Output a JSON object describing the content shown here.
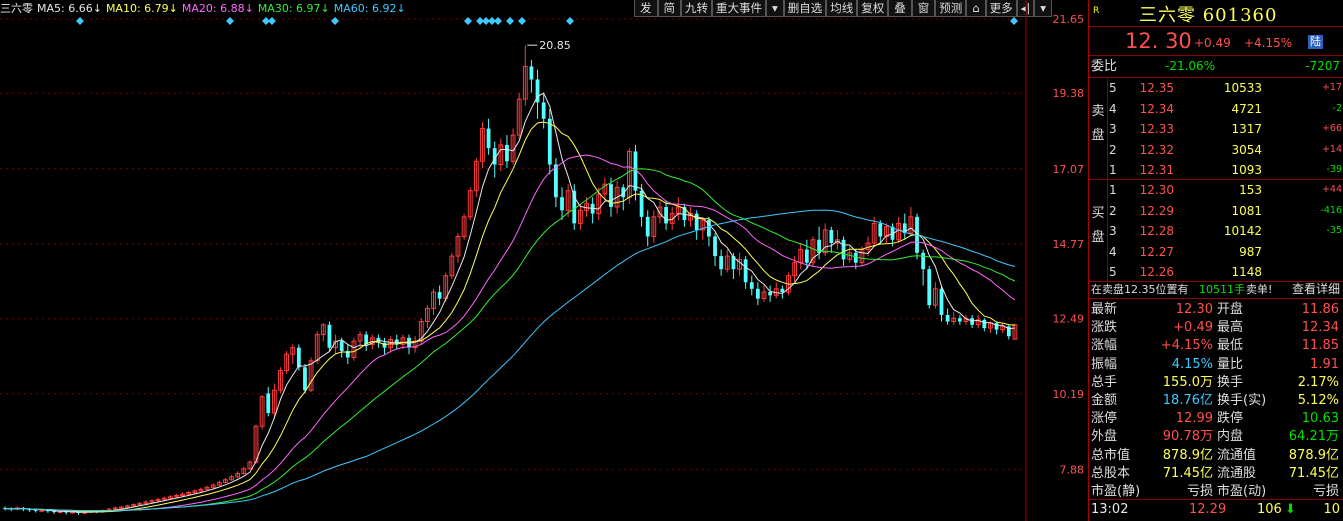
{
  "indicators": [
    {
      "label": "三六零",
      "value": "",
      "color": "#e8e8e8"
    },
    {
      "label": "MA5:",
      "value": "6.66↓",
      "color": "#e8e8e8"
    },
    {
      "label": "MA10:",
      "value": "6.79↓",
      "color": "#ffff55"
    },
    {
      "label": "MA20:",
      "value": "6.88↓",
      "color": "#ff66ff"
    },
    {
      "label": "MA30:",
      "value": "6.97↓",
      "color": "#33ee33"
    },
    {
      "label": "MA60:",
      "value": "6.92↓",
      "color": "#40c8ff"
    }
  ],
  "toolbar": [
    "发",
    "简",
    "九转",
    "重大事件",
    "▾",
    "删自选",
    "均线",
    "复权",
    "叠",
    "窗",
    "预测",
    "⌂",
    "更多",
    "◂|",
    "▾"
  ],
  "chart_data": {
    "type": "candlestick",
    "y_ticks": [
      "21.65",
      "19.38",
      "17.07",
      "14.77",
      "12.49",
      "10.19",
      "7.88"
    ],
    "ylim": [
      6.3,
      21.65
    ],
    "high_marker": "20.85",
    "ma_colors": {
      "ma5": "#e8e8e8",
      "ma10": "#ffff55",
      "ma20": "#ff66ff",
      "ma30": "#33ee33",
      "ma60": "#40c8ff"
    },
    "candles": [
      [
        6.7,
        6.68,
        6.75,
        6.62
      ],
      [
        6.68,
        6.66,
        6.72,
        6.6
      ],
      [
        6.66,
        6.7,
        6.74,
        6.63
      ],
      [
        6.7,
        6.66,
        6.73,
        6.6
      ],
      [
        6.66,
        6.64,
        6.7,
        6.58
      ],
      [
        6.64,
        6.61,
        6.68,
        6.56
      ],
      [
        6.61,
        6.63,
        6.67,
        6.57
      ],
      [
        6.63,
        6.6,
        6.66,
        6.55
      ],
      [
        6.6,
        6.57,
        6.63,
        6.52
      ],
      [
        6.57,
        6.59,
        6.62,
        6.53
      ],
      [
        6.59,
        6.56,
        6.61,
        6.5
      ],
      [
        6.56,
        6.58,
        6.62,
        6.52
      ],
      [
        6.58,
        6.55,
        6.6,
        6.49
      ],
      [
        6.55,
        6.57,
        6.61,
        6.51
      ],
      [
        6.57,
        6.6,
        6.64,
        6.54
      ],
      [
        6.6,
        6.58,
        6.63,
        6.54
      ],
      [
        6.58,
        6.62,
        6.66,
        6.55
      ],
      [
        6.62,
        6.66,
        6.7,
        6.59
      ],
      [
        6.66,
        6.7,
        6.74,
        6.62
      ],
      [
        6.7,
        6.72,
        6.77,
        6.66
      ],
      [
        6.72,
        6.76,
        6.8,
        6.69
      ],
      [
        6.76,
        6.8,
        6.84,
        6.73
      ],
      [
        6.8,
        6.84,
        6.88,
        6.77
      ],
      [
        6.84,
        6.88,
        6.93,
        6.8
      ],
      [
        6.88,
        6.92,
        6.97,
        6.85
      ],
      [
        6.92,
        6.96,
        7.01,
        6.88
      ],
      [
        6.96,
        7.0,
        7.05,
        6.92
      ],
      [
        7.0,
        7.04,
        7.09,
        6.96
      ],
      [
        7.04,
        7.08,
        7.13,
        7.0
      ],
      [
        7.08,
        7.12,
        7.18,
        7.05
      ],
      [
        7.12,
        7.17,
        7.22,
        7.09
      ],
      [
        7.17,
        7.22,
        7.27,
        7.14
      ],
      [
        7.22,
        7.27,
        7.32,
        7.19
      ],
      [
        7.27,
        7.33,
        7.38,
        7.24
      ],
      [
        7.33,
        7.4,
        7.45,
        7.3
      ],
      [
        7.4,
        7.48,
        7.53,
        7.37
      ],
      [
        7.48,
        7.56,
        7.62,
        7.45
      ],
      [
        7.56,
        7.65,
        7.71,
        7.53
      ],
      [
        7.65,
        7.75,
        7.82,
        7.62
      ],
      [
        7.75,
        7.9,
        7.96,
        7.72
      ],
      [
        7.9,
        8.1,
        8.16,
        7.86
      ],
      [
        8.1,
        9.2,
        9.25,
        8.05
      ],
      [
        9.2,
        10.1,
        10.15,
        9.1
      ],
      [
        10.2,
        9.6,
        10.4,
        9.5
      ],
      [
        9.6,
        10.3,
        10.5,
        9.45
      ],
      [
        10.3,
        10.9,
        11.0,
        10.2
      ],
      [
        10.9,
        11.4,
        11.5,
        10.8
      ],
      [
        11.4,
        11.6,
        11.7,
        11.1
      ],
      [
        11.6,
        11.0,
        11.7,
        10.9
      ],
      [
        11.0,
        10.3,
        11.1,
        10.2
      ],
      [
        10.3,
        11.2,
        11.3,
        10.25
      ],
      [
        11.2,
        12.0,
        12.1,
        11.1
      ],
      [
        12.0,
        12.3,
        12.35,
        11.8
      ],
      [
        12.3,
        11.6,
        12.4,
        11.5
      ],
      [
        11.6,
        11.8,
        12.0,
        11.4
      ],
      [
        11.8,
        11.5,
        11.9,
        11.3
      ],
      [
        11.5,
        11.3,
        11.7,
        11.1
      ],
      [
        11.3,
        11.8,
        11.9,
        11.2
      ],
      [
        11.8,
        12.0,
        12.1,
        11.6
      ],
      [
        12.0,
        11.7,
        12.1,
        11.5
      ],
      [
        11.7,
        11.9,
        12.0,
        11.55
      ],
      [
        11.9,
        11.75,
        12.0,
        11.6
      ],
      [
        11.75,
        11.6,
        11.9,
        11.4
      ],
      [
        11.6,
        11.85,
        11.95,
        11.45
      ],
      [
        11.85,
        11.7,
        12.0,
        11.55
      ],
      [
        11.7,
        11.9,
        12.0,
        11.55
      ],
      [
        11.9,
        11.6,
        12.0,
        11.4
      ],
      [
        11.6,
        11.8,
        11.95,
        11.45
      ],
      [
        11.8,
        12.4,
        12.5,
        11.7
      ],
      [
        12.4,
        12.8,
        12.9,
        12.2
      ],
      [
        12.8,
        13.3,
        13.4,
        12.6
      ],
      [
        13.3,
        13.1,
        13.5,
        12.9
      ],
      [
        13.1,
        13.8,
        13.9,
        13.0
      ],
      [
        13.8,
        14.4,
        14.5,
        13.7
      ],
      [
        14.4,
        15.0,
        15.1,
        14.2
      ],
      [
        15.0,
        15.6,
        15.7,
        14.9
      ],
      [
        15.6,
        16.4,
        16.5,
        15.5
      ],
      [
        16.4,
        17.3,
        17.4,
        16.2
      ],
      [
        17.3,
        18.3,
        18.5,
        17.1
      ],
      [
        18.3,
        17.7,
        18.6,
        17.5
      ],
      [
        17.7,
        17.2,
        17.9,
        16.8
      ],
      [
        17.2,
        17.8,
        18.0,
        17.0
      ],
      [
        17.8,
        17.3,
        18.1,
        17.1
      ],
      [
        17.3,
        18.1,
        18.3,
        17.2
      ],
      [
        18.1,
        19.2,
        19.4,
        18.0
      ],
      [
        19.2,
        20.2,
        20.85,
        19.0
      ],
      [
        20.2,
        19.8,
        20.4,
        19.4
      ],
      [
        19.8,
        19.1,
        20.1,
        18.6
      ],
      [
        19.1,
        18.6,
        19.4,
        18.3
      ],
      [
        18.6,
        17.2,
        18.9,
        16.9
      ],
      [
        17.2,
        16.2,
        17.4,
        15.9
      ],
      [
        16.2,
        15.8,
        16.5,
        15.5
      ],
      [
        15.8,
        16.4,
        16.6,
        15.6
      ],
      [
        16.4,
        15.4,
        16.6,
        15.2
      ],
      [
        15.4,
        15.8,
        16.0,
        15.2
      ],
      [
        15.8,
        16.0,
        16.2,
        15.6
      ],
      [
        16.0,
        15.7,
        16.2,
        15.4
      ],
      [
        15.7,
        16.3,
        16.5,
        15.5
      ],
      [
        16.3,
        16.6,
        16.8,
        16.1
      ],
      [
        16.6,
        15.9,
        16.8,
        15.6
      ],
      [
        15.9,
        16.5,
        16.7,
        15.7
      ],
      [
        16.5,
        16.2,
        16.6,
        15.8
      ],
      [
        16.2,
        17.6,
        17.7,
        16.0
      ],
      [
        17.6,
        16.4,
        17.8,
        16.1
      ],
      [
        16.4,
        15.6,
        16.6,
        15.3
      ],
      [
        15.6,
        15.0,
        15.8,
        14.7
      ],
      [
        15.0,
        15.6,
        15.8,
        14.8
      ],
      [
        15.6,
        15.9,
        16.1,
        15.4
      ],
      [
        15.9,
        15.4,
        16.1,
        15.2
      ],
      [
        15.4,
        15.7,
        15.9,
        15.2
      ],
      [
        15.7,
        15.9,
        16.2,
        15.5
      ],
      [
        15.9,
        15.5,
        16.0,
        15.3
      ],
      [
        15.5,
        15.7,
        15.9,
        15.3
      ],
      [
        15.7,
        15.2,
        15.8,
        14.9
      ],
      [
        15.2,
        15.5,
        15.6,
        14.9
      ],
      [
        15.5,
        15.0,
        15.6,
        14.7
      ],
      [
        15.0,
        14.4,
        15.1,
        14.1
      ],
      [
        14.4,
        14.0,
        14.6,
        13.8
      ],
      [
        14.0,
        14.4,
        14.6,
        13.9
      ],
      [
        14.4,
        14.0,
        14.5,
        13.7
      ],
      [
        14.0,
        14.3,
        14.5,
        13.8
      ],
      [
        14.3,
        13.6,
        14.4,
        13.4
      ],
      [
        13.6,
        13.4,
        13.8,
        13.2
      ],
      [
        13.4,
        13.1,
        13.6,
        12.9
      ],
      [
        13.1,
        13.3,
        13.5,
        13.0
      ],
      [
        13.3,
        13.2,
        13.5,
        13.0
      ],
      [
        13.2,
        13.4,
        13.6,
        13.1
      ],
      [
        13.4,
        13.3,
        13.5,
        13.1
      ],
      [
        13.3,
        13.8,
        13.9,
        13.2
      ],
      [
        13.8,
        14.2,
        14.4,
        13.6
      ],
      [
        14.2,
        14.6,
        14.8,
        14.0
      ],
      [
        14.6,
        14.2,
        14.9,
        14.0
      ],
      [
        14.2,
        14.9,
        15.0,
        14.1
      ],
      [
        14.9,
        14.5,
        15.3,
        14.3
      ],
      [
        14.5,
        15.2,
        15.4,
        14.4
      ],
      [
        15.2,
        14.8,
        15.3,
        14.5
      ],
      [
        14.8,
        14.9,
        15.2,
        14.6
      ],
      [
        14.9,
        14.3,
        15.0,
        14.1
      ],
      [
        14.3,
        14.5,
        14.7,
        14.2
      ],
      [
        14.5,
        14.2,
        14.6,
        14.0
      ],
      [
        14.2,
        14.6,
        14.7,
        14.1
      ],
      [
        14.6,
        14.8,
        15.0,
        14.4
      ],
      [
        14.8,
        15.4,
        15.6,
        14.7
      ],
      [
        15.4,
        15.0,
        15.5,
        14.8
      ],
      [
        15.0,
        15.3,
        15.4,
        14.8
      ],
      [
        15.3,
        14.9,
        15.4,
        14.7
      ],
      [
        14.9,
        15.4,
        15.6,
        14.8
      ],
      [
        15.4,
        15.1,
        15.7,
        14.9
      ],
      [
        15.1,
        15.6,
        15.9,
        15.0
      ],
      [
        15.6,
        14.5,
        15.7,
        14.3
      ],
      [
        14.5,
        14.0,
        14.6,
        13.5
      ],
      [
        14.0,
        12.9,
        14.1,
        12.8
      ],
      [
        12.9,
        13.4,
        13.6,
        12.8
      ],
      [
        13.4,
        12.6,
        13.5,
        12.4
      ],
      [
        12.6,
        12.4,
        12.8,
        12.3
      ],
      [
        12.4,
        12.5,
        12.7,
        12.3
      ],
      [
        12.5,
        12.4,
        12.6,
        12.3
      ],
      [
        12.4,
        12.5,
        12.6,
        12.3
      ],
      [
        12.5,
        12.3,
        12.6,
        12.2
      ],
      [
        12.3,
        12.45,
        12.6,
        12.2
      ],
      [
        12.45,
        12.2,
        12.5,
        12.1
      ],
      [
        12.2,
        12.35,
        12.4,
        12.05
      ],
      [
        12.35,
        12.15,
        12.4,
        12.0
      ],
      [
        12.15,
        12.25,
        12.35,
        12.05
      ],
      [
        12.25,
        11.95,
        12.3,
        11.85
      ],
      [
        11.86,
        12.3,
        12.34,
        11.85
      ]
    ]
  },
  "panel": {
    "badge": "R",
    "title": "三六零 601360",
    "price": "12. 30",
    "change": "+0.49",
    "change_pct": "+4.15%",
    "market": "陆",
    "wb_label": "委比",
    "wb_pct": "-21.06%",
    "wb_diff": "-7207",
    "sell_label": [
      "卖",
      "盘"
    ],
    "buy_label": [
      "买",
      "盘"
    ],
    "asks": [
      {
        "lvl": "5",
        "price": "12.35",
        "vol": "10533",
        "chg": "+17"
      },
      {
        "lvl": "4",
        "price": "12.34",
        "vol": "4721",
        "chg": "-2"
      },
      {
        "lvl": "3",
        "price": "12.33",
        "vol": "1317",
        "chg": "+66"
      },
      {
        "lvl": "2",
        "price": "12.32",
        "vol": "3054",
        "chg": "+14"
      },
      {
        "lvl": "1",
        "price": "12.31",
        "vol": "1093",
        "chg": "-39"
      }
    ],
    "bids": [
      {
        "lvl": "1",
        "price": "12.30",
        "vol": "153",
        "chg": "+44"
      },
      {
        "lvl": "2",
        "price": "12.29",
        "vol": "1081",
        "chg": "-416"
      },
      {
        "lvl": "3",
        "price": "12.28",
        "vol": "10142",
        "chg": "-35"
      },
      {
        "lvl": "4",
        "price": "12.27",
        "vol": "987",
        "chg": ""
      },
      {
        "lvl": "5",
        "price": "12.26",
        "vol": "1148",
        "chg": ""
      }
    ],
    "note_a": "在卖盘12.35位置有",
    "note_b": "10511手",
    "note_c": "卖单!",
    "note_link": "查看详细",
    "stats": [
      [
        "最新",
        "12.30",
        "red",
        "开盘",
        "11.86",
        "red"
      ],
      [
        "涨跌",
        "+0.49",
        "red",
        "最高",
        "12.34",
        "red"
      ],
      [
        "涨幅",
        "+4.15%",
        "red",
        "最低",
        "11.85",
        "red"
      ],
      [
        "振幅",
        "4.15%",
        "cyan",
        "量比",
        "1.91",
        "red"
      ],
      [
        "总手",
        "155.0万",
        "yellow",
        "换手",
        "2.17%",
        "yellow"
      ],
      [
        "金额",
        "18.76亿",
        "cyan",
        "换手(实)",
        "5.12%",
        "yellow"
      ],
      [
        "涨停",
        "12.99",
        "red",
        "跌停",
        "10.63",
        "green"
      ],
      [
        "外盘",
        "90.78万",
        "red",
        "内盘",
        "64.21万",
        "green"
      ],
      [
        "总市值",
        "878.9亿",
        "yellow",
        "流通值",
        "878.9亿",
        "yellow"
      ],
      [
        "总股本",
        "71.45亿",
        "yellow",
        "流通股",
        "71.45亿",
        "yellow"
      ],
      [
        "市盈(静)",
        "亏损",
        "white",
        "市盈(动)",
        "亏损",
        "white"
      ]
    ],
    "bottom": {
      "time": "13:02",
      "price": "12.29",
      "vol": "106",
      "arrow": "⬇",
      "count": "10"
    }
  }
}
